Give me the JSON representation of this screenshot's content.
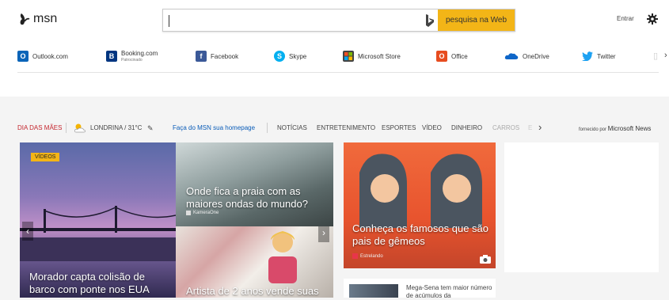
{
  "header": {
    "logo_text": "msn",
    "search_placeholder": "",
    "search_button": "pesquisa na Web",
    "signin": "Entrar"
  },
  "quick_links": [
    {
      "label": "Outlook.com",
      "sub": "",
      "icon": "outlook-icon",
      "color": "#0a64b8"
    },
    {
      "label": "Booking.com",
      "sub": "Patrocinado",
      "icon": "booking-icon",
      "color": "#003580"
    },
    {
      "label": "Facebook",
      "sub": "",
      "icon": "facebook-icon",
      "color": "#3b5998"
    },
    {
      "label": "Skype",
      "sub": "",
      "icon": "skype-icon",
      "color": "#00aff0"
    },
    {
      "label": "Microsoft Store",
      "sub": "",
      "icon": "microsoft-store-icon",
      "color": "#444444"
    },
    {
      "label": "Office",
      "sub": "",
      "icon": "office-icon",
      "color": "#e74c1f"
    },
    {
      "label": "OneDrive",
      "sub": "",
      "icon": "onedrive-icon",
      "color": "#0e66c8"
    },
    {
      "label": "Twitter",
      "sub": "",
      "icon": "twitter-icon",
      "color": "#1da1f2"
    }
  ],
  "nav": {
    "special": "DIA DAS MÃES",
    "weather": "LONDRINA / 31°C",
    "homepage": "Faça do MSN sua homepage",
    "items": [
      "NOTÍCIAS",
      "ENTRETENIMENTO",
      "ESPORTES",
      "VÍDEO",
      "DINHEIRO",
      "CARROS",
      "E"
    ],
    "powered_prefix": "fornecido por",
    "powered_brand": "Microsoft News"
  },
  "tiles": {
    "hero": {
      "badge": "VÍDEOS",
      "title": "Morador capta colisão de barco com ponte nos EUA"
    },
    "beach": {
      "title": "Onde fica a praia com as maiores ondas do mundo?",
      "source": "KameraOne"
    },
    "artist": {
      "title": "Artista de 2 anos vende suas"
    },
    "twins": {
      "title": "Conheça os famosos que são pais de gêmeos",
      "source": "Estrelando"
    }
  },
  "news_card": {
    "text": "Mega-Sena tem maior número de acúmulos da"
  },
  "colors": {
    "accent": "#f3b517",
    "special": "#c4262e",
    "link": "#0a5cb8"
  }
}
